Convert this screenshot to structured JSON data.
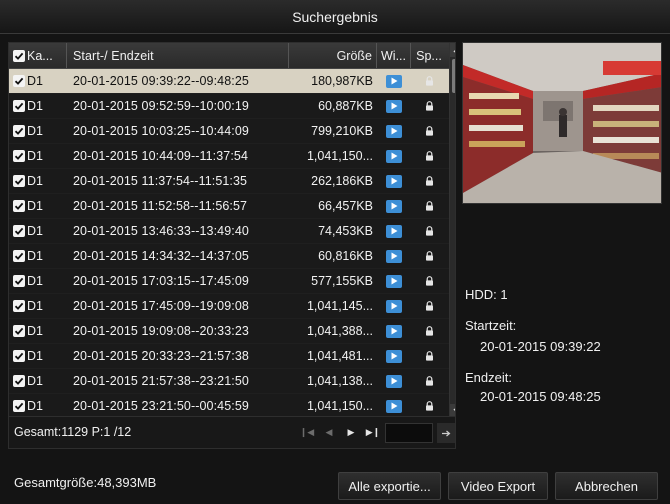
{
  "window": {
    "title": "Suchergebnis"
  },
  "table": {
    "columns": {
      "camera": "Ka...",
      "time": "Start-/ Endzeit",
      "size": "Größe",
      "play": "Wi...",
      "lock": "Sp..."
    },
    "rows": [
      {
        "camera": "D1",
        "time": "20-01-2015 09:39:22--09:48:25",
        "size": "180,987KB",
        "checked": true,
        "selected": true
      },
      {
        "camera": "D1",
        "time": "20-01-2015 09:52:59--10:00:19",
        "size": "60,887KB",
        "checked": true
      },
      {
        "camera": "D1",
        "time": "20-01-2015 10:03:25--10:44:09",
        "size": "799,210KB",
        "checked": true
      },
      {
        "camera": "D1",
        "time": "20-01-2015 10:44:09--11:37:54",
        "size": "1,041,150...",
        "checked": true
      },
      {
        "camera": "D1",
        "time": "20-01-2015 11:37:54--11:51:35",
        "size": "262,186KB",
        "checked": true
      },
      {
        "camera": "D1",
        "time": "20-01-2015 11:52:58--11:56:57",
        "size": "66,457KB",
        "checked": true
      },
      {
        "camera": "D1",
        "time": "20-01-2015 13:46:33--13:49:40",
        "size": "74,453KB",
        "checked": true
      },
      {
        "camera": "D1",
        "time": "20-01-2015 14:34:32--14:37:05",
        "size": "60,816KB",
        "checked": true
      },
      {
        "camera": "D1",
        "time": "20-01-2015 17:03:15--17:45:09",
        "size": "577,155KB",
        "checked": true
      },
      {
        "camera": "D1",
        "time": "20-01-2015 17:45:09--19:09:08",
        "size": "1,041,145...",
        "checked": true
      },
      {
        "camera": "D1",
        "time": "20-01-2015 19:09:08--20:33:23",
        "size": "1,041,388...",
        "checked": true
      },
      {
        "camera": "D1",
        "time": "20-01-2015 20:33:23--21:57:38",
        "size": "1,041,481...",
        "checked": true
      },
      {
        "camera": "D1",
        "time": "20-01-2015 21:57:38--23:21:50",
        "size": "1,041,138...",
        "checked": true
      },
      {
        "camera": "D1",
        "time": "20-01-2015 23:21:50--00:45:59",
        "size": "1,041,150...",
        "checked": true
      }
    ]
  },
  "footer": {
    "total": "Gesamt:1129 P:1 /12"
  },
  "details": {
    "hdd": "HDD: 1",
    "start_label": "Startzeit:",
    "start_value": "20-01-2015 09:39:22",
    "end_label": "Endzeit:",
    "end_value": "20-01-2015 09:48:25"
  },
  "bottom": {
    "total_size": "Gesamtgröße:48,393MB",
    "export_all": "Alle exportie...",
    "video_export": "Video Export",
    "cancel": "Abbrechen"
  },
  "colors": {
    "play_icon": "#3d8fd6",
    "selected_row": "#d8d2c2"
  }
}
